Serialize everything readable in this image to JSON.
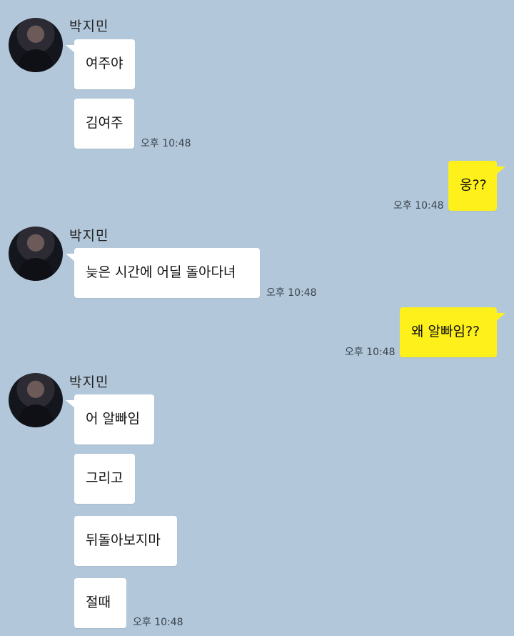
{
  "groups": [
    {
      "sender": "박지민",
      "messages": [
        "여주야",
        "김여주"
      ],
      "time": "오후 10:48"
    },
    {
      "mine": true,
      "messages": [
        "웅??"
      ],
      "time": "오후 10:48"
    },
    {
      "sender": "박지민",
      "messages": [
        "늦은 시간에 어딜 돌아다녀"
      ],
      "time": "오후 10:48"
    },
    {
      "mine": true,
      "messages": [
        "왜 알빠임??"
      ],
      "time": "오후 10:48"
    },
    {
      "sender": "박지민",
      "messages": [
        "어 알빠임",
        "그리고",
        "뒤돌아보지마",
        "절때"
      ],
      "time": "오후 10:48"
    }
  ],
  "colors": {
    "background": "#b2c7d9",
    "bubble_in": "#ffffff",
    "bubble_out": "#fef01b"
  }
}
